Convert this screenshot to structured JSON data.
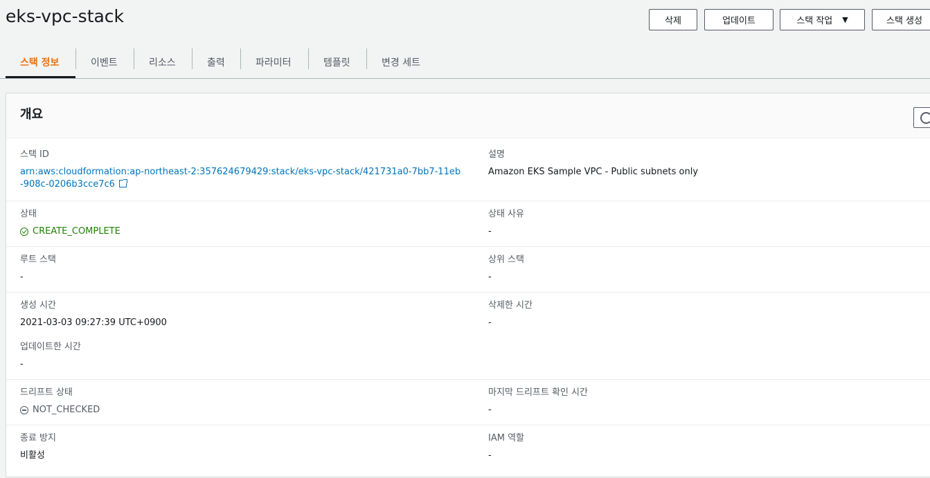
{
  "page": {
    "title": "eks-vpc-stack"
  },
  "actions": {
    "delete": "삭제",
    "update": "업데이트",
    "stack_actions": "스택 작업",
    "stack_actions_caret": "▼",
    "create_stack": "스택 생성"
  },
  "tabs": [
    {
      "label": "스택 정보",
      "active": true
    },
    {
      "label": "이벤트"
    },
    {
      "label": "리소스"
    },
    {
      "label": "출력"
    },
    {
      "label": "파라미터"
    },
    {
      "label": "템플릿"
    },
    {
      "label": "변경 세트"
    }
  ],
  "overview": {
    "title": "개요",
    "stack_id": {
      "label": "스택 ID",
      "value": "arn:aws:cloudformation:ap-northeast-2:357624679429:stack/eks-vpc-stack/421731a0-7bb7-11eb-908c-0206b3cce7c6"
    },
    "description": {
      "label": "설명",
      "value": "Amazon EKS Sample VPC - Public subnets only"
    },
    "status": {
      "label": "상태",
      "value": "CREATE_COMPLETE"
    },
    "status_reason": {
      "label": "상태 사유",
      "value": "-"
    },
    "root_stack": {
      "label": "루트 스택",
      "value": "-"
    },
    "parent_stack": {
      "label": "상위 스택",
      "value": "-"
    },
    "created_time": {
      "label": "생성 시간",
      "value": "2021-03-03 09:27:39 UTC+0900"
    },
    "deleted_time": {
      "label": "삭제한 시간",
      "value": "-"
    },
    "updated_time": {
      "label": "업데이트한 시간",
      "value": "-"
    },
    "drift_status": {
      "label": "드리프트 상태",
      "value": "NOT_CHECKED"
    },
    "last_drift_check": {
      "label": "마지막 드리프트 확인 시간",
      "value": "-"
    },
    "termination_protection": {
      "label": "종료 방지",
      "value": "비활성"
    },
    "iam_role": {
      "label": "IAM 역할",
      "value": "-"
    }
  },
  "colors": {
    "accent_tab": "#ec7211",
    "link": "#0073bb",
    "success": "#1d8102"
  }
}
